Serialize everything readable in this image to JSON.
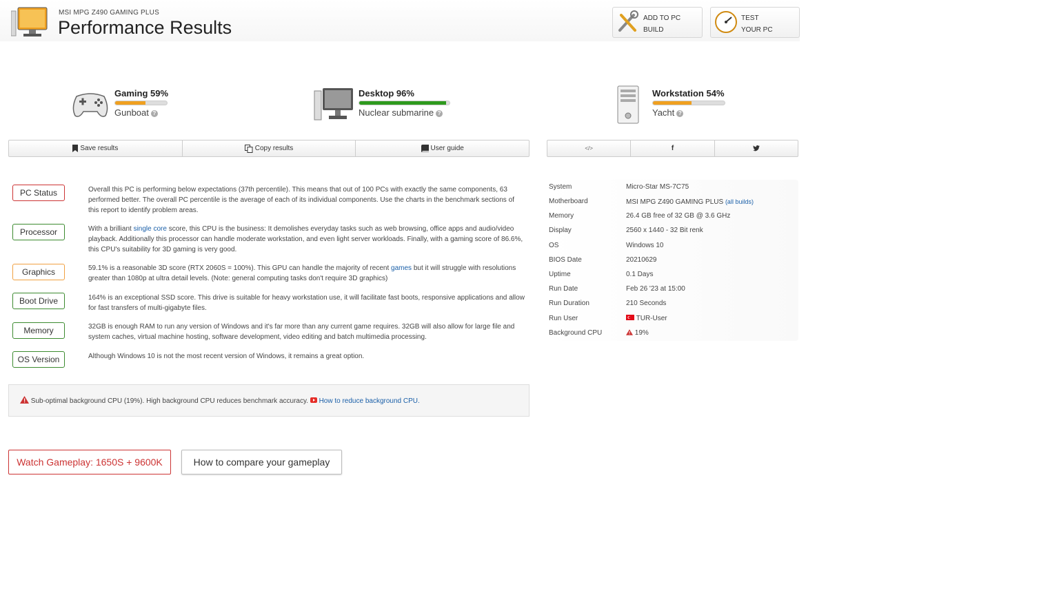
{
  "header": {
    "subtitle": "MSI MPG Z490 GAMING PLUS",
    "title": "Performance Results",
    "add_build_line1": "ADD TO PC",
    "add_build_line2": "BUILD",
    "test_pc_line1": "TEST",
    "test_pc_line2": "YOUR PC"
  },
  "scores": [
    {
      "name": "Gaming 59%",
      "percent": 59,
      "sub": "Gunboat",
      "color": "#f0a020"
    },
    {
      "name": "Desktop 96%",
      "percent": 96,
      "sub": "Nuclear submarine",
      "color": "#2e9a1e"
    },
    {
      "name": "Workstation 54%",
      "percent": 54,
      "sub": "Yacht",
      "color": "#f0a020"
    }
  ],
  "actions": {
    "save": "Save results",
    "copy": "Copy results",
    "guide": "User guide"
  },
  "share": {
    "embed": "</>",
    "facebook": "f",
    "twitter": "🐦"
  },
  "status": [
    {
      "tag": "PC Status",
      "text": "Overall this PC is performing below expectations (37th percentile). This means that out of 100 PCs with exactly the same components, 63 performed better. The overall PC percentile is the average of each of its individual components. Use the charts in the benchmark sections of this report to identify problem areas."
    },
    {
      "tag": "Processor",
      "pre": "With a brilliant ",
      "link": "single core",
      "post": " score, this CPU is the business: It demolishes everyday tasks such as web browsing, office apps and audio/video playback. Additionally this processor can handle moderate workstation, and even light server workloads. Finally, with a gaming score of 86.6%, this CPU's suitability for 3D gaming is very good."
    },
    {
      "tag": "Graphics",
      "pre": "59.1% is a reasonable 3D score (RTX 2060S = 100%). This GPU can handle the majority of recent ",
      "link": "games",
      "post": " but it will struggle with resolutions greater than 1080p at ultra detail levels. (Note: general computing tasks don't require 3D graphics)"
    },
    {
      "tag": "Boot Drive",
      "text": "164% is an exceptional SSD score. This drive is suitable for heavy workstation use, it will facilitate fast boots, responsive applications and allow for fast transfers of multi-gigabyte files."
    },
    {
      "tag": "Memory",
      "text": "32GB is enough RAM to run any version of Windows and it's far more than any current game requires. 32GB will also allow for large file and system caches, virtual machine hosting, software development, video editing and batch multimedia processing."
    },
    {
      "tag": "OS Version",
      "text": "Although Windows 10 is not the most recent version of Windows, it remains a great option."
    }
  ],
  "warning": {
    "text": "Sub-optimal background CPU (19%). High background CPU reduces benchmark accuracy. ",
    "link": "How to reduce background CPU."
  },
  "gameplay": {
    "watch": "Watch Gameplay: 1650S + 9600K",
    "compare": "How to compare your gameplay"
  },
  "system": [
    {
      "key": "System",
      "value": "Micro-Star MS-7C75"
    },
    {
      "key": "Motherboard",
      "value": "MSI MPG Z490 GAMING PLUS",
      "link": "(all builds)"
    },
    {
      "key": "Memory",
      "value": "26.4 GB free of 32 GB @ 3.6 GHz"
    },
    {
      "key": "Display",
      "value": "2560 x 1440 - 32 Bit renk"
    },
    {
      "key": "OS",
      "value": "Windows 10"
    },
    {
      "key": "BIOS Date",
      "value": "20210629"
    },
    {
      "key": "Uptime",
      "value": "0.1 Days"
    },
    {
      "key": "Run Date",
      "value": "Feb 26 '23 at 15:00"
    },
    {
      "key": "Run Duration",
      "value": "210 Seconds"
    },
    {
      "key": "Run User",
      "value": "TUR-User"
    },
    {
      "key": "Background CPU",
      "value": "19%"
    }
  ]
}
